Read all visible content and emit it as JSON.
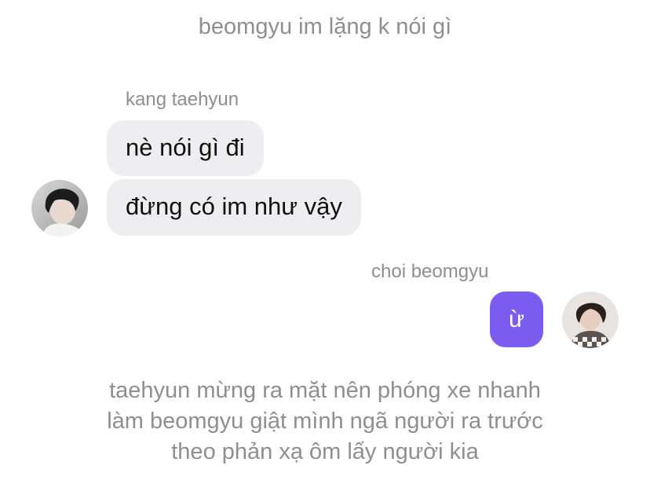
{
  "narration_top": "beomgyu im lặng k nói gì",
  "left_sender": {
    "name": "kang taehyun",
    "messages": [
      "nè nói gì đi",
      "đừng có im như vậy"
    ]
  },
  "right_sender": {
    "name": "choi beomgyu",
    "messages": [
      "ừ"
    ]
  },
  "narration_bottom": {
    "lines": [
      "taehyun mừng ra mặt nên phóng xe nhanh",
      "làm beomgyu giật mình ngã người ra trước",
      "theo phản xạ ôm lấy người kia"
    ]
  },
  "colors": {
    "narration": "#8e8e93",
    "incoming_bubble": "#eeeef0",
    "outgoing_bubble": "#7b5cf0"
  }
}
